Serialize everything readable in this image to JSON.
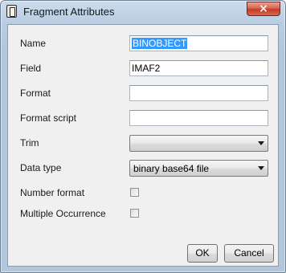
{
  "window": {
    "title": "Fragment Attributes",
    "close_label": "×"
  },
  "fields": {
    "name": {
      "label": "Name",
      "value": "BINOBJECT"
    },
    "field": {
      "label": "Field",
      "value": "IMAF2"
    },
    "format": {
      "label": "Format",
      "value": ""
    },
    "format_script": {
      "label": "Format script",
      "value": ""
    },
    "trim": {
      "label": "Trim",
      "selected": ""
    },
    "data_type": {
      "label": "Data type",
      "selected": "binary base64 file"
    },
    "number_format": {
      "label": "Number format",
      "checked": false
    },
    "multiple_occurrence": {
      "label": "Multiple Occurrence",
      "checked": false
    }
  },
  "buttons": {
    "ok": "OK",
    "cancel": "Cancel"
  },
  "icons": {
    "app": "document-icon",
    "close": "close-icon",
    "dropdown": "chevron-down-icon"
  },
  "colors": {
    "title_bar": "#b9cde2",
    "client_bg": "#f0f0f0",
    "selection": "#3399ff",
    "close_button": "#c23b26"
  }
}
